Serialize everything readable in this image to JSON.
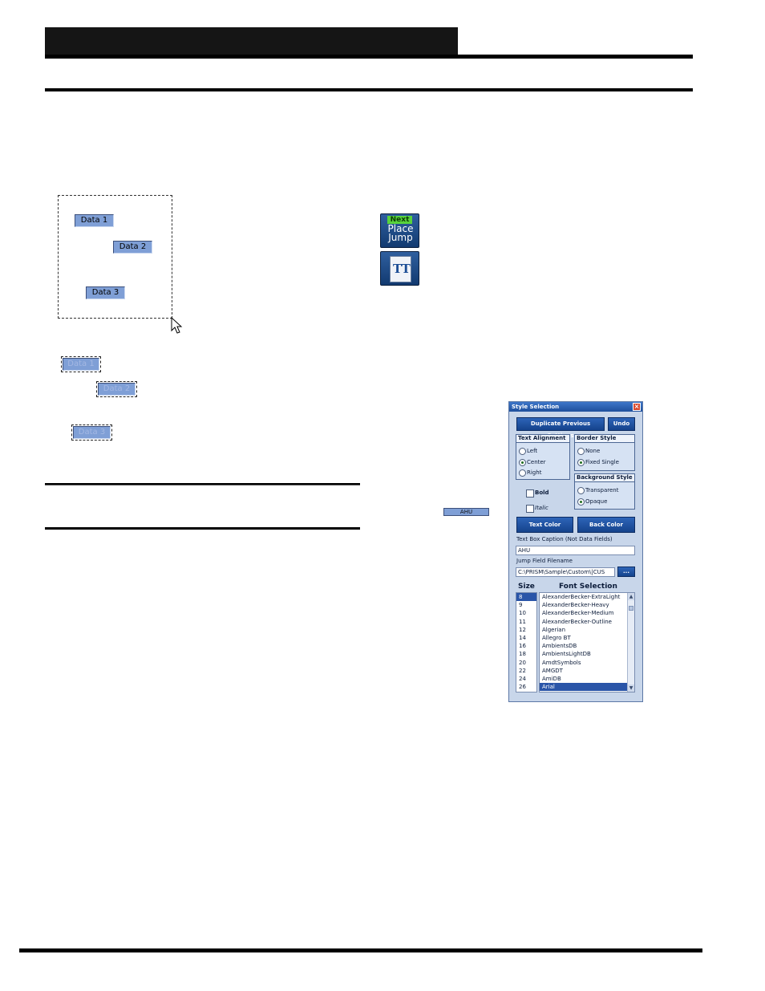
{
  "fields": {
    "original": [
      "Data 1",
      "Data 2",
      "Data 3"
    ],
    "selected": [
      "Data 1",
      "Data 2",
      "Data 3"
    ]
  },
  "toolbar": {
    "next_place_jump": {
      "top": "Next",
      "line1": "Place",
      "line2": "Jump",
      "icon": "next-place-jump-icon"
    },
    "text_tool": {
      "glyph": "TT",
      "icon": "text-tool-icon"
    }
  },
  "preview": {
    "caption": "AHU"
  },
  "dialog": {
    "title": "Style Selection",
    "close_glyph": "×",
    "duplicate_label": "Duplicate Previous Settings",
    "undo_label": "Undo",
    "text_alignment": {
      "title": "Text Alignment",
      "options": [
        "Left",
        "Center",
        "Right"
      ],
      "selected": "Center"
    },
    "border_style": {
      "title": "Border Style",
      "options": [
        "None",
        "Fixed Single"
      ],
      "selected": "Fixed Single"
    },
    "background_style": {
      "title": "Background Style",
      "options": [
        "Transparent",
        "Opaque"
      ],
      "selected": "Opaque"
    },
    "bold_label": "Bold",
    "italic_label": "Italic",
    "text_color_label": "Text Color",
    "back_color_label": "Back Color",
    "caption_label": "Text Box Caption (Not Data Fields)",
    "caption_value": "AHU",
    "jump_label": "Jump Field Filename",
    "jump_value": "C:\\PRISM\\Sample\\Custom\\|CUS",
    "browse_label": "...",
    "size_header": "Size",
    "font_header": "Font Selection",
    "sizes": [
      "8",
      "9",
      "10",
      "11",
      "12",
      "14",
      "16",
      "18",
      "20",
      "22",
      "24",
      "26"
    ],
    "selected_size": "8",
    "fonts": [
      "AlexanderBecker-ExtraLight",
      "AlexanderBecker-Heavy",
      "AlexanderBecker-Medium",
      "AlexanderBecker-Outline",
      "Algerian",
      "Allegro BT",
      "AmbientsDB",
      "AmbientsLightDB",
      "AmdtSymbols",
      "AMGDT",
      "AmiDB",
      "Arial"
    ],
    "selected_font": "Arial"
  },
  "colors": {
    "field_fill": "#7f9fd6",
    "dialog_bg": "#c8d6ea",
    "button_blue": "#1f55a6"
  }
}
